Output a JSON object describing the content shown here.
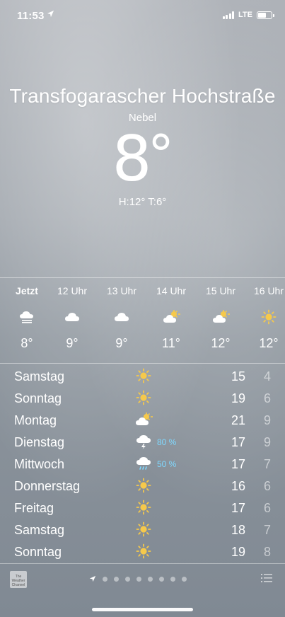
{
  "status_bar": {
    "time": "11:53",
    "network": "LTE",
    "location_icon": "location-arrow-icon",
    "battery_level": 0.7
  },
  "header": {
    "city": "Transfogarascher Hochstraße",
    "condition": "Nebel",
    "temperature": "8",
    "temp_unit": "°",
    "hilo": "H:12°  T:6°"
  },
  "hourly": [
    {
      "label": "Jetzt",
      "icon": "fog-icon",
      "temp": "8°"
    },
    {
      "label": "12 Uhr",
      "icon": "cloud-icon",
      "temp": "9°"
    },
    {
      "label": "13 Uhr",
      "icon": "cloud-icon",
      "temp": "9°"
    },
    {
      "label": "14 Uhr",
      "icon": "partly-cloudy-icon",
      "temp": "11°"
    },
    {
      "label": "15 Uhr",
      "icon": "partly-cloudy-icon",
      "temp": "12°"
    },
    {
      "label": "16 Uhr",
      "icon": "sun-icon",
      "temp": "12°"
    }
  ],
  "daily": [
    {
      "day": "Samstag",
      "icon": "sun-icon",
      "precip": "",
      "high": "15",
      "low": "4"
    },
    {
      "day": "Sonntag",
      "icon": "sun-icon",
      "precip": "",
      "high": "19",
      "low": "6"
    },
    {
      "day": "Montag",
      "icon": "partly-cloudy-icon",
      "precip": "",
      "high": "21",
      "low": "9"
    },
    {
      "day": "Dienstag",
      "icon": "thunderstorm-icon",
      "precip": "80 %",
      "high": "17",
      "low": "9"
    },
    {
      "day": "Mittwoch",
      "icon": "rain-icon",
      "precip": "50 %",
      "high": "17",
      "low": "7"
    },
    {
      "day": "Donnerstag",
      "icon": "sun-icon",
      "precip": "",
      "high": "16",
      "low": "6"
    },
    {
      "day": "Freitag",
      "icon": "sun-icon",
      "precip": "",
      "high": "17",
      "low": "6"
    },
    {
      "day": "Samstag",
      "icon": "sun-icon",
      "precip": "",
      "high": "18",
      "low": "7"
    },
    {
      "day": "Sonntag",
      "icon": "sun-icon",
      "precip": "",
      "high": "19",
      "low": "8"
    }
  ],
  "bottom_bar": {
    "logo_text": "The Weather Channel",
    "page_dots": 8,
    "list_icon": "list-icon"
  },
  "colors": {
    "sun": "#f6c94b",
    "precip": "#7fd8ff"
  }
}
